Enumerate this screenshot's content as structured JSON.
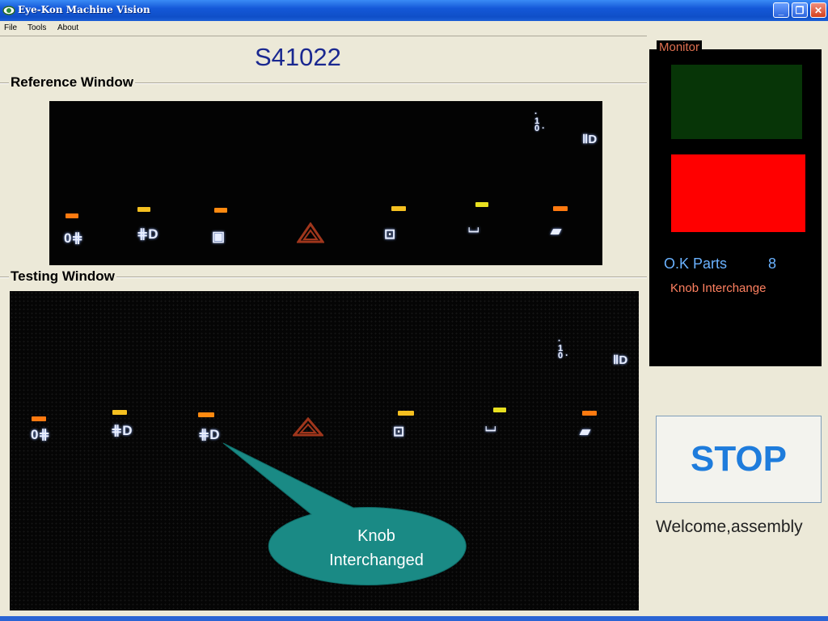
{
  "window": {
    "title": "Eye-Kon Machine Vision",
    "controls": {
      "minimize": "_",
      "maximize": "❐",
      "close": "✕"
    }
  },
  "menu": [
    {
      "label": "File"
    },
    {
      "label": "Tools"
    },
    {
      "label": "About"
    }
  ],
  "part_id": "S41022",
  "reference_window": {
    "title": "Reference Window"
  },
  "testing_window": {
    "title": "Testing Window"
  },
  "monitor": {
    "title": "Monitor",
    "ok_parts_label": "O.K Parts",
    "ok_parts_count": "8",
    "fault_text": "Knob Interchange"
  },
  "stop_button": {
    "label": "STOP"
  },
  "welcome_text": "Welcome,assembly",
  "callout": {
    "line1": "Knob",
    "line2": "Interchanged",
    "fill": "#1a8a85"
  },
  "colors": {
    "ok_indicator": "#073507",
    "fault_indicator": "#ff0000",
    "stop_text": "#1e7cdc"
  },
  "switch_panel": {
    "reference_order": [
      "rear-fog",
      "front-fog",
      "rear-defrost",
      "hazard",
      "rear-wiper",
      "rear-washer",
      "rear-wash-wipe"
    ],
    "testing_order": [
      "rear-fog",
      "front-fog",
      "front-fog",
      "hazard",
      "rear-wiper",
      "rear-washer",
      "rear-wash-wipe"
    ]
  }
}
